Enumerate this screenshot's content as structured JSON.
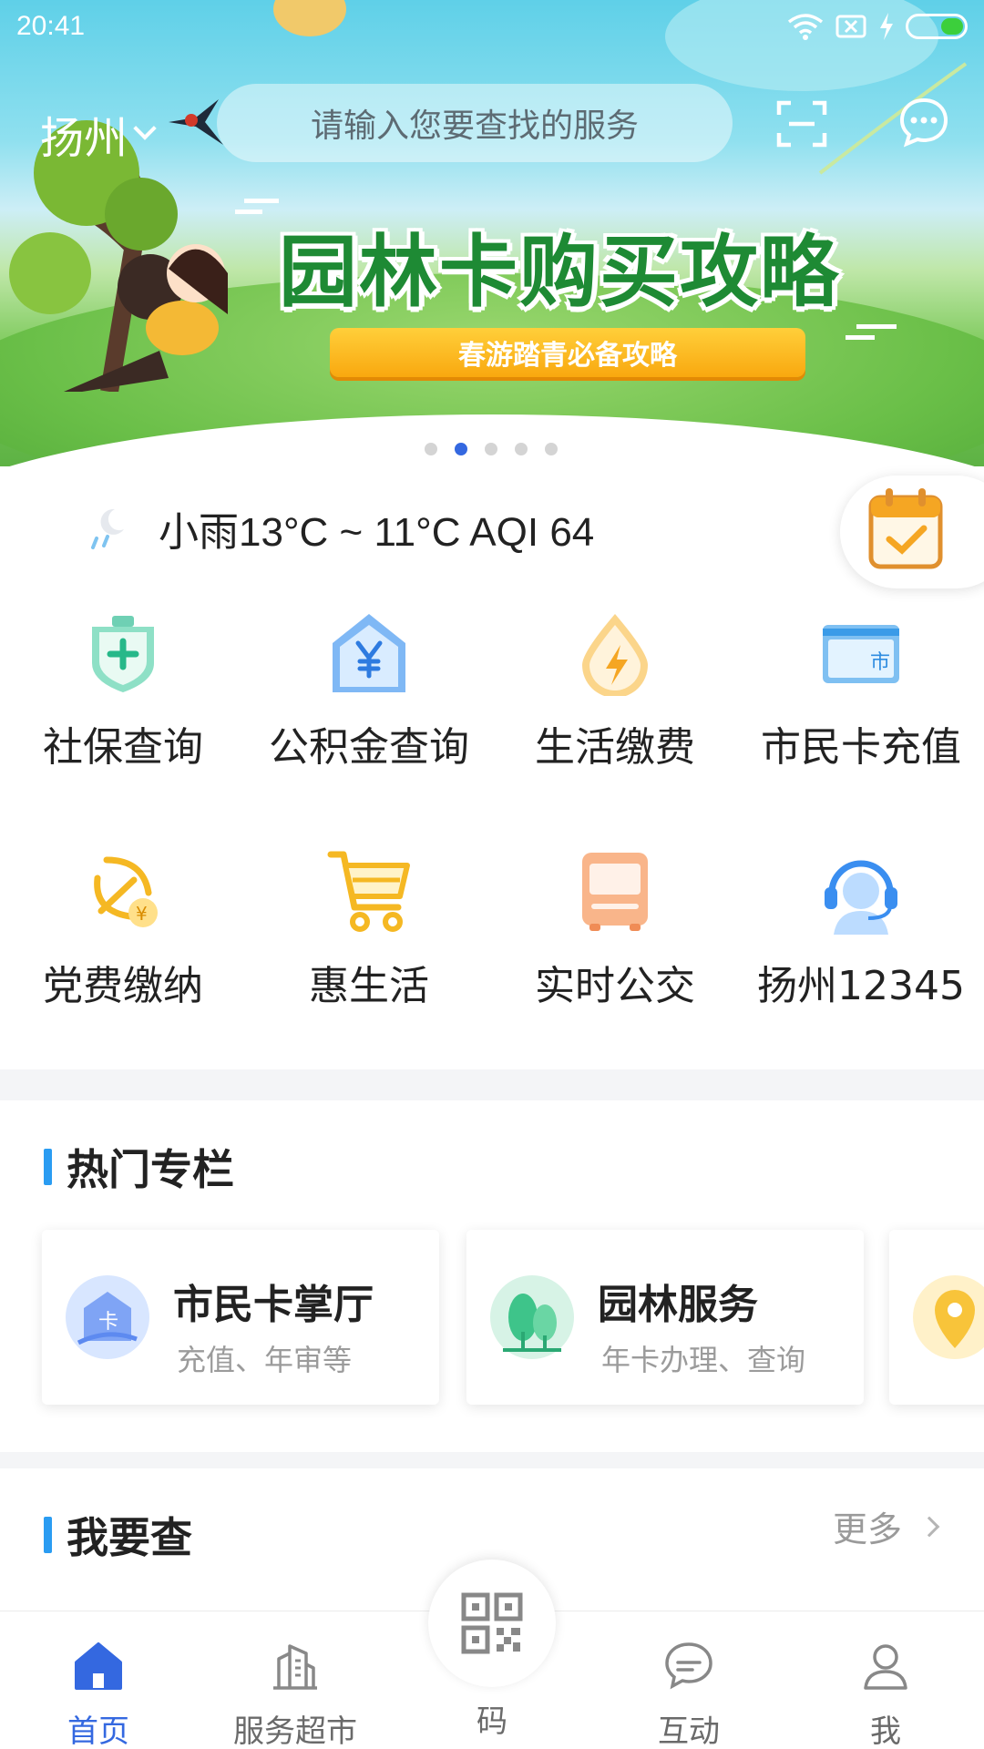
{
  "status_bar": {
    "time": "20:41"
  },
  "header": {
    "city": "扬州",
    "search_placeholder": "请输入您要查找的服务"
  },
  "banner": {
    "title": "园林卡购买攻略",
    "subtitle": "春游踏青必备攻略",
    "dots_total": 5,
    "active_dot": 2
  },
  "weather": {
    "text": "小雨13°C ~ 11°C AQI 64"
  },
  "services": [
    {
      "label": "社保查询",
      "icon": "medical-shield-icon"
    },
    {
      "label": "公积金查询",
      "icon": "fund-house-icon"
    },
    {
      "label": "生活缴费",
      "icon": "lightning-drop-icon"
    },
    {
      "label": "市民卡充值",
      "icon": "citizen-card-icon"
    },
    {
      "label": "党费缴纳",
      "icon": "party-emblem-coin-icon"
    },
    {
      "label": "惠生活",
      "icon": "shopping-cart-icon"
    },
    {
      "label": "实时公交",
      "icon": "bus-icon"
    },
    {
      "label": "扬州12345",
      "icon": "customer-service-icon"
    }
  ],
  "hot_section": {
    "title": "热门专栏",
    "cards": [
      {
        "title": "市民卡掌厅",
        "subtitle": "充值、年审等",
        "icon": "card-hall-icon"
      },
      {
        "title": "园林服务",
        "subtitle": "年卡办理、查询",
        "icon": "trees-icon"
      }
    ]
  },
  "query_section": {
    "title": "我要查",
    "more": "更多"
  },
  "bottom_nav": [
    {
      "label": "首页",
      "icon": "home-icon",
      "active": true
    },
    {
      "label": "服务超市",
      "icon": "building-icon",
      "active": false
    },
    {
      "label": "码",
      "icon": "qr-code-icon",
      "active": false
    },
    {
      "label": "互动",
      "icon": "chat-bubble-icon",
      "active": false
    },
    {
      "label": "我",
      "icon": "user-icon",
      "active": false
    }
  ],
  "colors": {
    "accent": "#3468e0",
    "section_bar": "#2a9cf2",
    "banner_title": "#1e8a34",
    "pill": "#f9a80f"
  }
}
